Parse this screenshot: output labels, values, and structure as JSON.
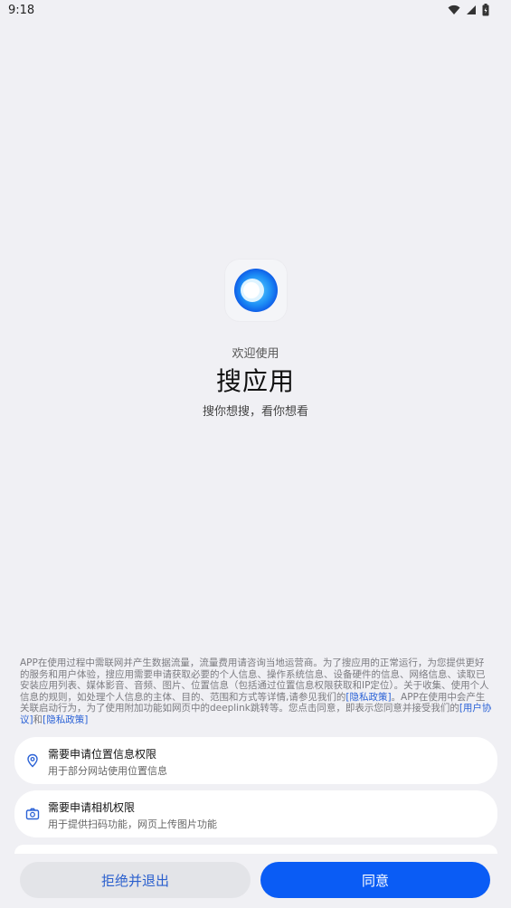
{
  "status_bar": {
    "time": "9:18",
    "icons": [
      "wifi-icon",
      "signal-icon",
      "battery-icon"
    ]
  },
  "header": {
    "welcome": "欢迎使用",
    "app_name": "搜应用",
    "slogan": "搜你想搜，看你想看"
  },
  "policy": {
    "part1": "APP在使用过程中需联网并产生数据流量，流量费用请咨询当地运营商。为了搜应用的正常运行，为您提供更好的服务和用户体验，搜应用需要申请获取必要的个人信息、操作系统信息、设备硬件的信息、网络信息、读取已安装应用列表、媒体影音、音频、图片、位置信息（包括通过位置信息权限获取和IP定位）。关于收集、使用个人信息的规则，如处理个人信息的主体、目的、范围和方式等详情,请参见我们的",
    "link_privacy_1": "[隐私政策]",
    "part2": "。APP在使用中会产生关联启动行为，为了使用附加功能如网页中的deeplink跳转等。您点击同意，即表示您同意并接受我们的",
    "link_user_agreement": "[用户协议]",
    "part3": "和",
    "link_privacy_2": "[隐私政策]"
  },
  "permissions": [
    {
      "icon": "location-pin-icon",
      "title": "需要申请位置信息权限",
      "desc": "用于部分网站使用位置信息"
    },
    {
      "icon": "camera-icon",
      "title": "需要申请相机权限",
      "desc": "用于提供扫码功能，网页上传图片功能"
    }
  ],
  "buttons": {
    "reject": "拒绝并退出",
    "agree": "同意"
  },
  "colors": {
    "accent": "#0a5cf5",
    "link": "#2b62d6",
    "background": "#f0f0f4"
  }
}
